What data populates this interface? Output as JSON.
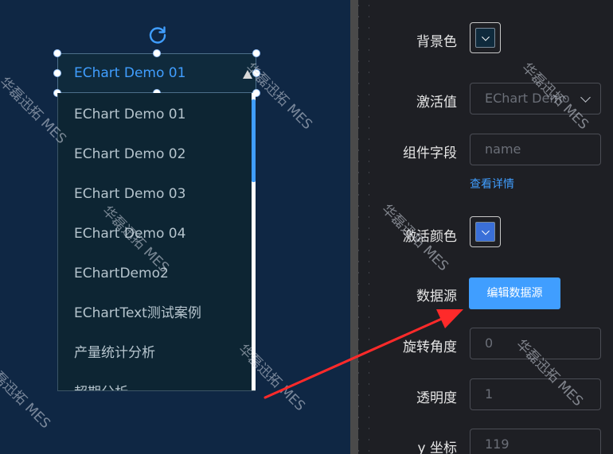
{
  "canvas": {
    "selected_value": "EChart Demo 01",
    "options": [
      "EChart Demo 01",
      "EChart Demo 02",
      "EChart Demo 03",
      "EChart Demo 04",
      "EChartDemo2",
      "EChartText测试案例",
      "产量统计分析",
      "超期分析"
    ]
  },
  "panel": {
    "background_color_label": "背景色",
    "active_value_label": "激活值",
    "active_value": "EChart Demo",
    "component_field_label": "组件字段",
    "component_field_placeholder": "name",
    "view_details_link": "查看详情",
    "active_color_label": "激活颜色",
    "data_source_label": "数据源",
    "edit_data_source_button": "编辑数据源",
    "rotation_label": "旋转角度",
    "rotation_value": "0",
    "opacity_label": "透明度",
    "opacity_value": "1",
    "y_label": "y 坐标",
    "y_value": "119"
  },
  "watermark": "华磊迅拓 MES",
  "colors": {
    "accent": "#409eff",
    "background_swatch": "#0f2a3c",
    "active_swatch": "#3a6fd8",
    "arrow": "#ff2a2a"
  },
  "icons": [
    "rotate-icon",
    "caret-up-icon",
    "chevron-down-icon"
  ]
}
